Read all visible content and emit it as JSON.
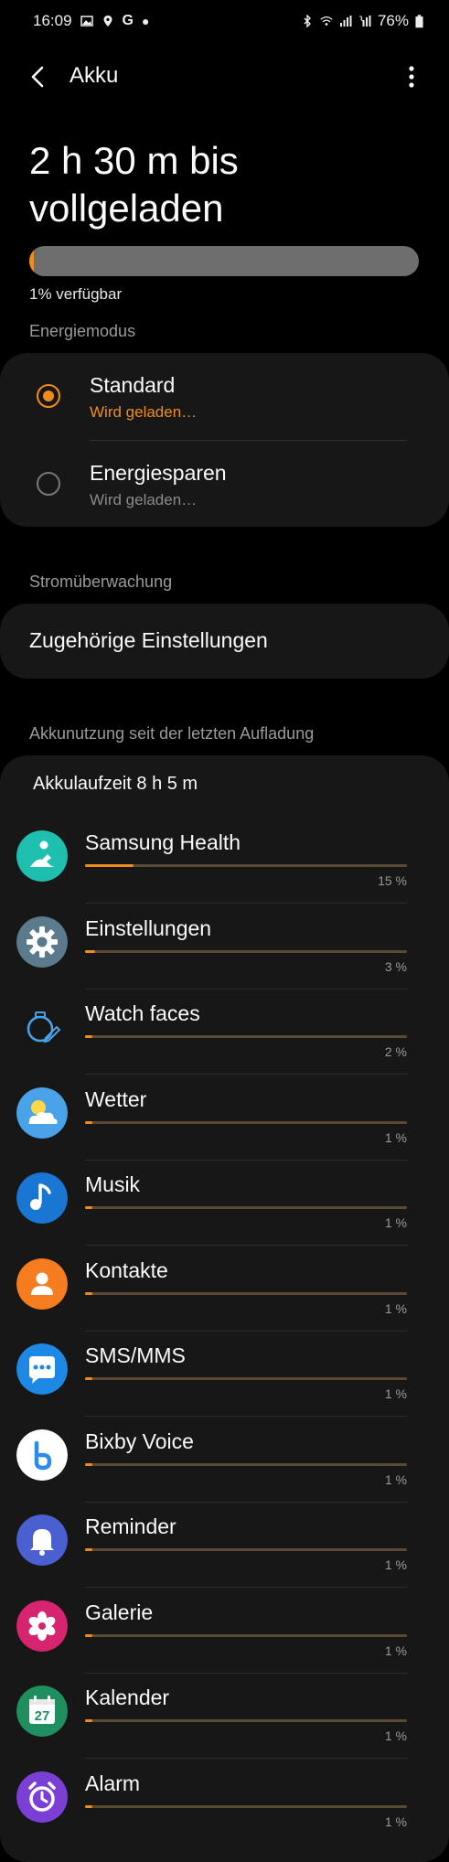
{
  "status_bar": {
    "time": "16:09",
    "left_icons": [
      "gallery-icon",
      "location-icon",
      "google-icon",
      "dot-icon"
    ],
    "right_icons": [
      "bluetooth-icon",
      "wifi-icon",
      "signal-icon",
      "call-signal-icon"
    ],
    "battery_text": "76%"
  },
  "app_bar": {
    "title": "Akku"
  },
  "hero": {
    "charge_text": "2 h 30 m bis vollgeladen",
    "battery_level": 0.01,
    "available_text": "1% verfügbar"
  },
  "energy_mode": {
    "header": "Energiemodus",
    "options": [
      {
        "label": "Standard",
        "sub": "Wird geladen…",
        "selected": true
      },
      {
        "label": "Energiesparen",
        "sub": "Wird geladen…",
        "selected": false
      }
    ]
  },
  "monitoring": {
    "header": "Stromüberwachung",
    "related_label": "Zugehörige Einstellungen"
  },
  "usage": {
    "header": "Akkunutzung seit der letzten Aufladung",
    "runtime": "Akkulaufzeit 8 h 5 m",
    "apps": [
      {
        "name": "Samsung Health",
        "percent": "15 %",
        "value": 15,
        "icon": "samsung-health-icon",
        "color": "#1fbfb0"
      },
      {
        "name": "Einstellungen",
        "percent": "3 %",
        "value": 3,
        "icon": "gear-icon",
        "color": "#5b7a8c"
      },
      {
        "name": "Watch faces",
        "percent": "2 %",
        "value": 2,
        "icon": "watch-faces-icon",
        "color": "#1d2a3a"
      },
      {
        "name": "Wetter",
        "percent": "1 %",
        "value": 1,
        "icon": "weather-icon",
        "color": "#4aa3e8"
      },
      {
        "name": "Musik",
        "percent": "1 %",
        "value": 1,
        "icon": "music-icon",
        "color": "#1976d2"
      },
      {
        "name": "Kontakte",
        "percent": "1 %",
        "value": 1,
        "icon": "contacts-icon",
        "color": "#f57c1f"
      },
      {
        "name": "SMS/MMS",
        "percent": "1 %",
        "value": 1,
        "icon": "messages-icon",
        "color": "#1e88e5"
      },
      {
        "name": "Bixby Voice",
        "percent": "1 %",
        "value": 1,
        "icon": "bixby-icon",
        "color": "#ffffff"
      },
      {
        "name": "Reminder",
        "percent": "1 %",
        "value": 1,
        "icon": "reminder-icon",
        "color": "#4a5fd0"
      },
      {
        "name": "Galerie",
        "percent": "1 %",
        "value": 1,
        "icon": "gallery-app-icon",
        "color": "#d6246e"
      },
      {
        "name": "Kalender",
        "percent": "1 %",
        "value": 1,
        "icon": "calendar-icon",
        "color": "#1f8f5f",
        "icon_text": "27"
      },
      {
        "name": "Alarm",
        "percent": "1 %",
        "value": 1,
        "icon": "alarm-icon",
        "color": "#7b3fd6"
      }
    ]
  },
  "colors": {
    "accent": "#f08c1e",
    "background": "#000000",
    "card": "#171717"
  }
}
